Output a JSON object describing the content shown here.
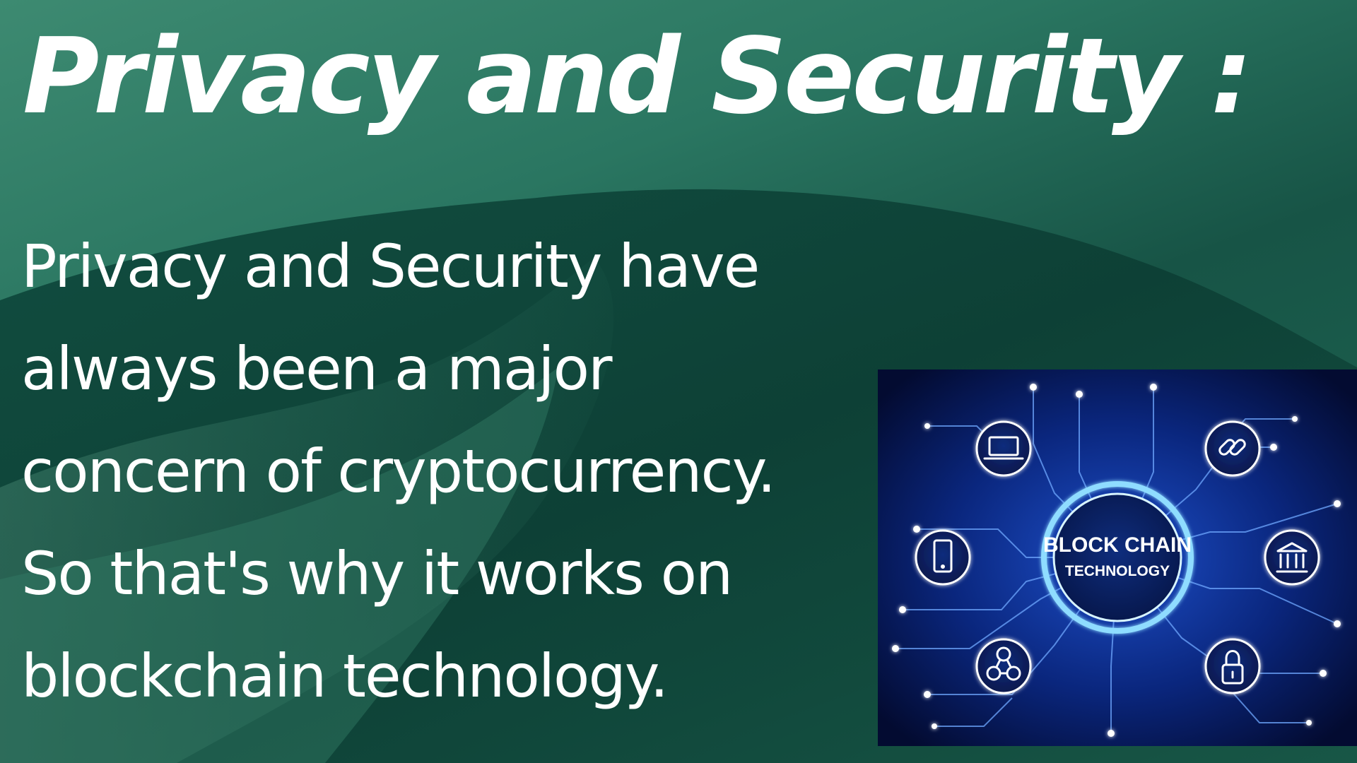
{
  "slide": {
    "title": "Privacy and Security :",
    "body": "Privacy and Security have always been a major concern of cryptocurrency. So that's why it works on blockchain technology."
  },
  "illustration": {
    "center_title": "BLOCK CHAIN",
    "center_subtitle": "TECHNOLOGY",
    "icons": [
      "laptop-icon",
      "link-icon",
      "tablet-icon",
      "bank-icon",
      "bitcoin-network-icon",
      "lock-icon"
    ]
  },
  "colors": {
    "background": "#2a7661",
    "text": "#ffffff",
    "circuit_background": "#06164a",
    "circuit_glow": "#8fdcff"
  }
}
